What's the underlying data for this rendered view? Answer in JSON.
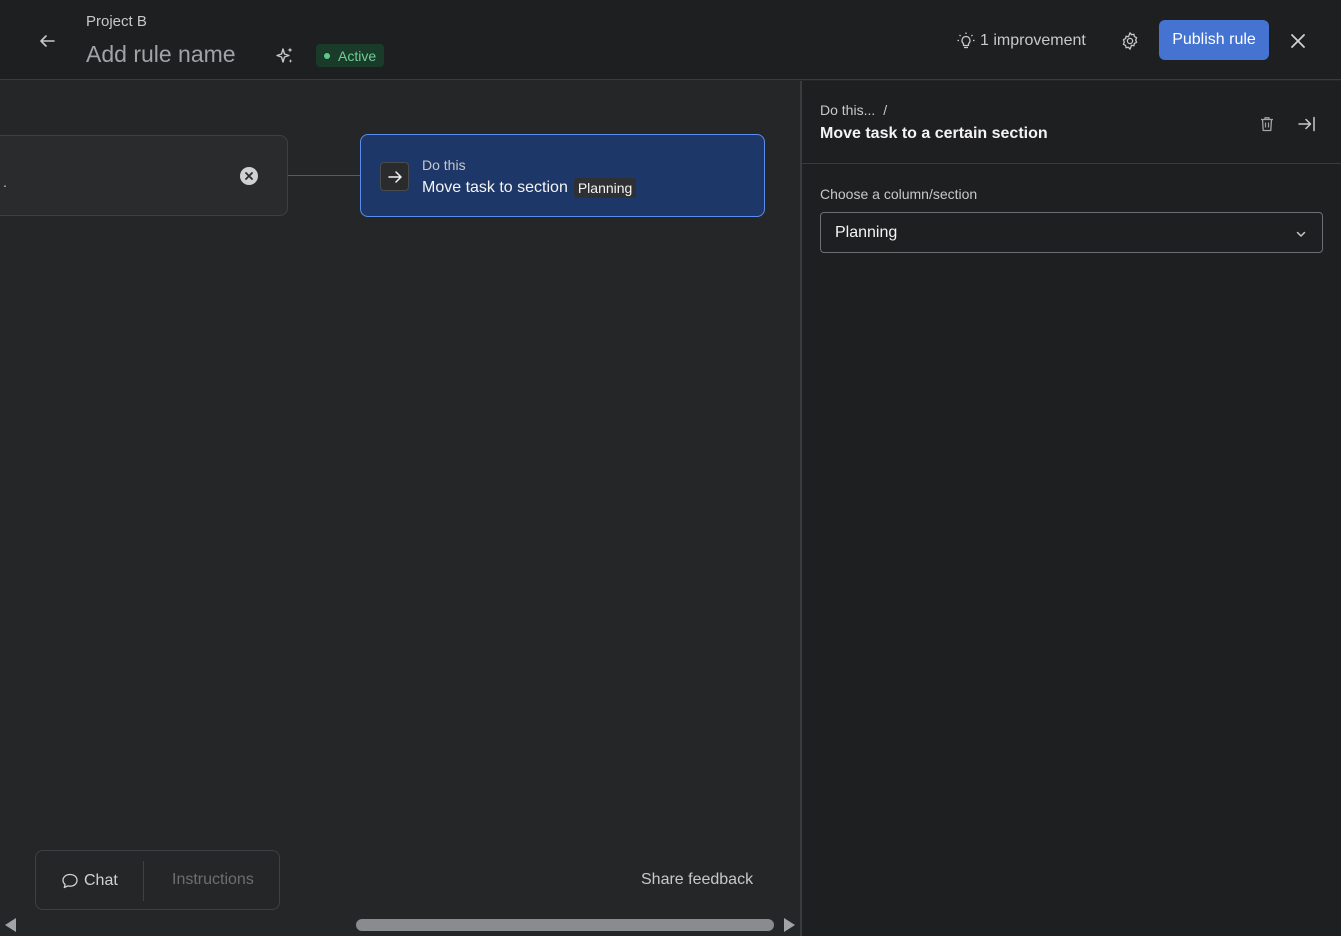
{
  "header": {
    "project_name": "Project B",
    "rule_name_placeholder": "Add rule name",
    "status": "Active",
    "improvement_label": "1 improvement",
    "publish_label": "Publish rule"
  },
  "canvas": {
    "trigger_text": ".",
    "action": {
      "label": "Do this",
      "description": "Move task to section",
      "chip": "Planning"
    },
    "tabs": {
      "chat": "Chat",
      "instructions": "Instructions"
    },
    "share_feedback": "Share feedback"
  },
  "panel": {
    "breadcrumb": "Do this...",
    "breadcrumb_sep": "/",
    "title": "Move task to a certain section",
    "field_label": "Choose a column/section",
    "selected_value": "Planning"
  },
  "colors": {
    "accent": "#4573d2",
    "status_green": "#6fcf97",
    "action_card_bg": "#1e3769",
    "action_card_border": "#5b8def"
  },
  "icons": [
    "arrow-left-icon",
    "sparkle-icon",
    "lightbulb-icon",
    "gear-icon",
    "close-icon",
    "clear-icon",
    "arrow-right-icon",
    "chat-bubble-icon",
    "trash-icon",
    "collapse-panel-icon",
    "chevron-down-icon"
  ]
}
